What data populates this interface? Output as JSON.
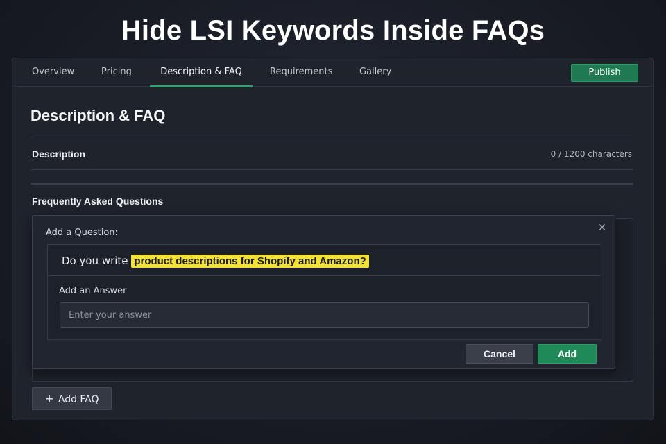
{
  "banner": {
    "title": "Hide LSI Keywords Inside FAQs"
  },
  "tabs": [
    {
      "label": "Overview"
    },
    {
      "label": "Pricing"
    },
    {
      "label": "Description & FAQ",
      "active": true
    },
    {
      "label": "Requirements"
    },
    {
      "label": "Gallery"
    }
  ],
  "toolbar": {
    "publish_label": "Publish"
  },
  "page": {
    "title": "Description & FAQ"
  },
  "description": {
    "label": "Description",
    "char_count": "0 / 1200 characters"
  },
  "faq": {
    "label": "Frequently Asked Questions",
    "add_faq_label": "Add FAQ"
  },
  "dialog": {
    "title": "Add a Question:",
    "question_prefix": "Do you write ",
    "question_highlight": "product descriptions for Shopify and Amazon?",
    "answer_label": "Add an Answer",
    "answer_placeholder": "Enter your answer",
    "cancel_label": "Cancel",
    "add_label": "Add"
  },
  "colors": {
    "accent": "#2fa46f",
    "highlight": "#f3e133",
    "publish": "#1f7a52"
  },
  "icons": {
    "close": "close-icon",
    "plus": "plus-icon"
  }
}
